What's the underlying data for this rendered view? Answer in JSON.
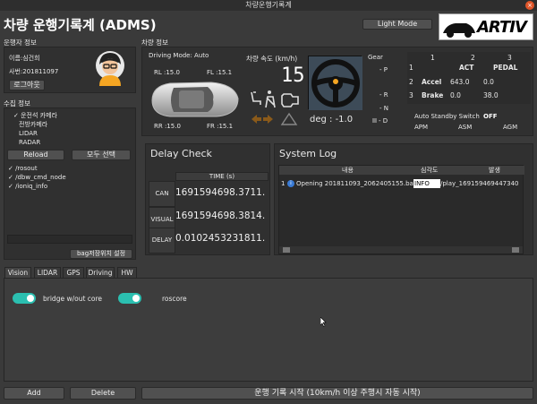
{
  "window": {
    "title": "차량운행기록계",
    "close": "×"
  },
  "app": {
    "title": "차량 운행기록계 (ADMS)",
    "light_mode_label": "Light Mode",
    "logo_text": "ARTIV"
  },
  "driver": {
    "section": "운행자 정보",
    "name": "이름:심건희",
    "employee_id": "사번:201811097",
    "logout_label": "로그아웃"
  },
  "collect": {
    "section": "수집 정보",
    "sensors": [
      "✓ 운전석 카메라",
      "전방카메라",
      "LIDAR",
      "RADAR"
    ],
    "reload_label": "Reload",
    "select_all_label": "모두 선택",
    "topics": [
      "✓ /rosout",
      "✓ /dbw_cmd_node",
      "✓ /ioniq_info"
    ],
    "bag_path_label": "bag저장위치 설정"
  },
  "vehicle": {
    "section": "차량 정보",
    "drive_mode": "Driving Mode: Auto",
    "rl": "RL :15.0",
    "fl": "FL :15.1",
    "rr": "RR :15.0",
    "fr": "FR :15.1",
    "speed_label": "차량 속도 (km/h)",
    "speed_value": "15",
    "deg": "deg : -1.0",
    "gear_label": "Gear",
    "gears": [
      "- P",
      "- R",
      "- N",
      "- D"
    ]
  },
  "pedal_table": {
    "col_headers": [
      "1",
      "2",
      "3"
    ],
    "headers": [
      "ACT",
      "PEDAL"
    ],
    "rows": [
      {
        "idx": "1",
        "name": "",
        "act": "",
        "pedal": ""
      },
      {
        "idx": "2",
        "name": "Accel",
        "act": "643.0",
        "pedal": "0.0"
      },
      {
        "idx": "3",
        "name": "Brake",
        "act": "0.0",
        "pedal": "38.0"
      }
    ]
  },
  "standby": {
    "label": "Auto Standby Switch",
    "state": "OFF",
    "apm": "APM",
    "asm": "ASM",
    "agm": "AGM"
  },
  "delay": {
    "title": "Delay Check",
    "header": "TIME (s)",
    "rows": [
      {
        "label": "CAN",
        "value": "1691594698.3711..."
      },
      {
        "label": "VISUAL",
        "value": "1691594698.3814..."
      },
      {
        "label": "DELAY",
        "value": "0.0102453231811..."
      }
    ]
  },
  "syslog": {
    "title": "System Log",
    "headers": [
      "내용",
      "심각도",
      "발생"
    ],
    "row_idx": "1",
    "message": "Opening 201811093_2062405155.bag",
    "severity": "INFO",
    "source": "/play_169159469447340"
  },
  "tabs": [
    "Vision",
    "LIDAR",
    "GPS",
    "Driving",
    "HW"
  ],
  "vision": {
    "bridge_label": "bridge w/out core",
    "roscore_label": "roscore"
  },
  "footer": {
    "add_label": "Add",
    "delete_label": "Delete",
    "start_label": "운행 기록 시작 (10km/h 이상 주행시 자동 시작)"
  }
}
